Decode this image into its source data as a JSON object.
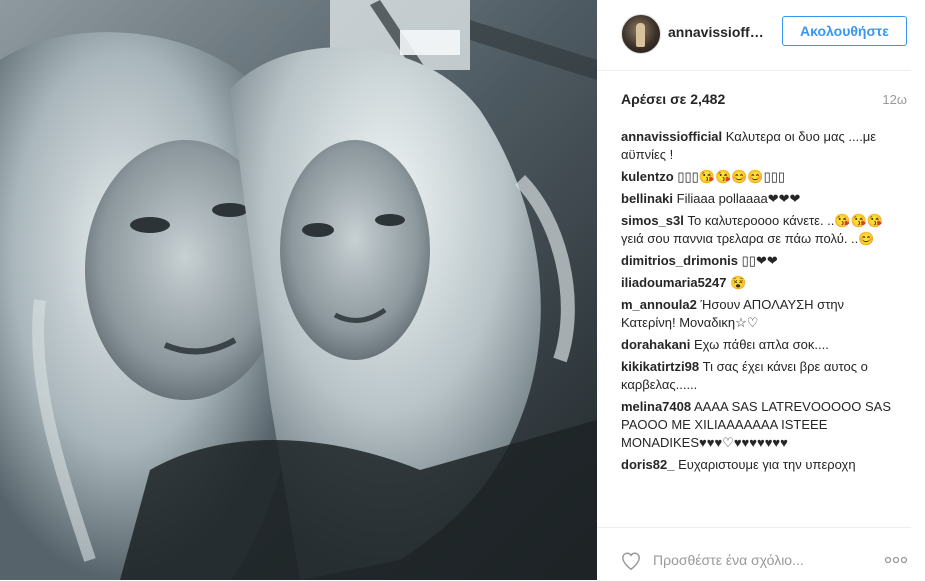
{
  "post": {
    "image_alt": "Black and white selfie of two blonde women",
    "username": "annavissioffi...",
    "follow_label": "Ακολουθήστε",
    "likes_label": "Αρέσει σε 2,482",
    "time_label": "12ω"
  },
  "comments": [
    {
      "user": "annavissiofficial",
      "text": "Καλυτερα οι δυο μας ....με αϋπνίες !"
    },
    {
      "user": "kulentzo",
      "text": "▯▯▯😘😘😊😊▯▯▯"
    },
    {
      "user": "bellinaki",
      "text": "Filiaaa pollaaaa❤❤❤"
    },
    {
      "user": "simos_s3l",
      "text": "Το καλυτεροοοο κάνετε. ..😘😘😘 γειά σου παννια τρελαρα σε πάω πολύ. ..😊"
    },
    {
      "user": "dimitrios_drimonis",
      "text": "▯▯❤❤"
    },
    {
      "user": "iliadoumaria5247",
      "text": "😵"
    },
    {
      "user": "m_annoula2",
      "text": "Ήσουν ΑΠΟΛΑΥΣΗ στην Κατερίνη! Μοναδικη☆♡"
    },
    {
      "user": "dorahakani",
      "text": "Εχω πάθει απλα σοκ...."
    },
    {
      "user": "kikikatirtzi98",
      "text": "Τι σας έχει κάνει βρε αυτος ο καρβελας......"
    },
    {
      "user": "melina7408",
      "text": "AAAA SAS LATREVOOOOO SAS PAOOO ME XILIAAAAAAA ISTEEE MONADIKES♥♥♥♡♥♥♥♥♥♥♥"
    },
    {
      "user": "doris82_",
      "text": "Ευχαριστουμε για την υπεροχη"
    }
  ],
  "footer": {
    "comment_placeholder": "Προσθέστε ένα σχόλιο...",
    "heart_icon": "heart-outline-icon",
    "more_icon": "more-options-icon"
  },
  "colors": {
    "accent": "#3897f0",
    "text": "#262626",
    "muted": "#999999",
    "divider": "#efefef"
  }
}
